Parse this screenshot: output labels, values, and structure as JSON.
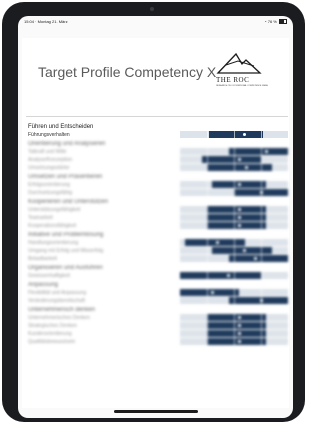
{
  "status_bar": {
    "time": "15:04 · Montag 21. März",
    "battery": "76 %"
  },
  "header": {
    "title": "Target Profile Competency X"
  },
  "logo": {
    "name": "THE ROC",
    "subtitle": "RESEARCH ON OCCUPATIONAL COMPETENCE GMBH"
  },
  "colors": {
    "bar": "#1f3a5c",
    "scale_bg": "#dde3ea"
  },
  "sections": [
    {
      "title": "Führen und Entscheiden",
      "blurred": false,
      "rows": [
        {
          "label": "Führungsverhalten",
          "start": 0.27,
          "end": 0.77,
          "marker": 0.6
        }
      ]
    },
    {
      "title": "Orientierung und Analysieren",
      "blurred": true,
      "rows": [
        {
          "label": "Tatkraft und Wille",
          "start": 0.45,
          "end": 1.0,
          "marker": 0.8
        },
        {
          "label": "Analyse/Konzeption",
          "start": 0.2,
          "end": 0.75,
          "marker": 0.55
        },
        {
          "label": "Umsetzungsstärke",
          "start": 0.25,
          "end": 0.85,
          "marker": 0.62
        }
      ]
    },
    {
      "title": "Umsetzen und Präsentieren",
      "blurred": true,
      "rows": [
        {
          "label": "Erfolgsorientierung",
          "start": 0.3,
          "end": 0.8,
          "marker": 0.55
        },
        {
          "label": "Durchsetzungsfähig",
          "start": 0.5,
          "end": 1.0,
          "marker": 0.75
        }
      ]
    },
    {
      "title": "Kooperieren und Unterstützen",
      "blurred": true,
      "rows": [
        {
          "label": "Unterstützungsfähigkeit",
          "start": 0.25,
          "end": 0.8,
          "marker": 0.55
        },
        {
          "label": "Teamarbeit",
          "start": 0.25,
          "end": 0.8,
          "marker": 0.55
        },
        {
          "label": "Kooperationsfähigkeit",
          "start": 0.25,
          "end": 0.8,
          "marker": 0.55
        }
      ]
    },
    {
      "title": "Initiative und Problemlösung",
      "blurred": true,
      "rows": [
        {
          "label": "Handlungsorientierung",
          "start": 0.05,
          "end": 0.6,
          "marker": 0.35
        },
        {
          "label": "Umgang mit Erfolg und Misserfolg",
          "start": 0.3,
          "end": 0.85,
          "marker": 0.6
        },
        {
          "label": "Belastbarkeit",
          "start": 0.45,
          "end": 1.0,
          "marker": 0.7
        }
      ]
    },
    {
      "title": "Organisieren und Ausführen",
      "blurred": true,
      "rows": [
        {
          "label": "Gewissenhaftigkeit",
          "start": 0.0,
          "end": 0.75,
          "marker": 0.45
        }
      ]
    },
    {
      "title": "Anpassung",
      "blurred": true,
      "rows": [
        {
          "label": "Flexibilität und Anpassung",
          "start": 0.0,
          "end": 0.55,
          "marker": 0.3
        },
        {
          "label": "Veränderungsbereitschaft",
          "start": 0.45,
          "end": 1.0,
          "marker": 0.75
        }
      ]
    },
    {
      "title": "Unternehmerisch denken",
      "blurred": true,
      "rows": [
        {
          "label": "Unternehmerisches Denken",
          "start": 0.25,
          "end": 0.8,
          "marker": 0.55
        },
        {
          "label": "Strategisches Denken",
          "start": 0.25,
          "end": 0.8,
          "marker": 0.55
        },
        {
          "label": "Kundenorientierung",
          "start": 0.25,
          "end": 0.8,
          "marker": 0.55
        },
        {
          "label": "Qualitätsbewusstsein",
          "start": 0.25,
          "end": 0.8,
          "marker": 0.55
        }
      ]
    }
  ]
}
